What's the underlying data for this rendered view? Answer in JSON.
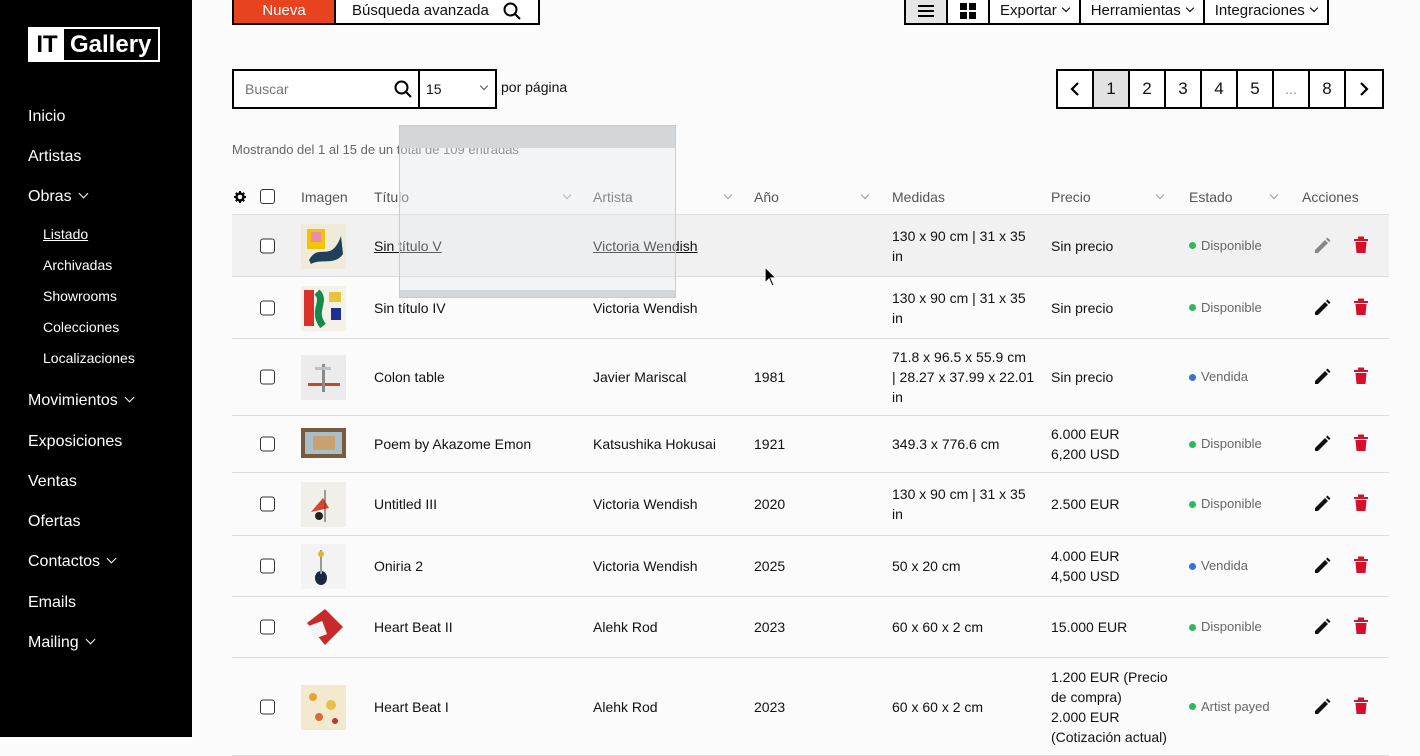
{
  "brand": {
    "it": "IT",
    "name": "Gallery"
  },
  "sidebar": {
    "items": [
      {
        "label": "Inicio"
      },
      {
        "label": "Artistas"
      },
      {
        "label": "Obras"
      },
      {
        "label": "Movimientos"
      },
      {
        "label": "Exposiciones"
      },
      {
        "label": "Ventas"
      },
      {
        "label": "Ofertas"
      },
      {
        "label": "Contactos"
      },
      {
        "label": "Emails"
      },
      {
        "label": "Mailing"
      }
    ],
    "subitems": [
      {
        "label": "Listado"
      },
      {
        "label": "Archivadas"
      },
      {
        "label": "Showrooms"
      },
      {
        "label": "Colecciones"
      },
      {
        "label": "Localizaciones"
      }
    ]
  },
  "toolbar": {
    "new_label": "Nueva",
    "advanced_search_label": "Búsqueda avanzada",
    "export_label": "Exportar",
    "tools_label": "Herramientas",
    "integrations_label": "Integraciones"
  },
  "search": {
    "placeholder": "Buscar",
    "per_page_value": "15",
    "per_page_label": "por página"
  },
  "pagination": {
    "pages": [
      "1",
      "2",
      "3",
      "4",
      "5",
      "...",
      "8"
    ],
    "current": "1"
  },
  "summary": "Mostrando del 1 al 15 de un total de 109 entradas",
  "table": {
    "headers": {
      "image": "Imagen",
      "title": "Título",
      "artist": "Artista",
      "year": "Año",
      "measures": "Medidas",
      "price": "Precio",
      "status": "Estado",
      "actions": "Acciones"
    },
    "rows": [
      {
        "title": "Sin título V",
        "artist": "Victoria Wendish",
        "year": "",
        "measures_1": "130 x 90 cm | 31 x 35",
        "measures_2": "in",
        "measures_3": "",
        "price_1": "Sin precio",
        "price_2": "",
        "price_3": "",
        "price_4": "",
        "status": "Disponible",
        "status_color": "#2eb85c"
      },
      {
        "title": "Sin título IV",
        "artist": "Victoria Wendish",
        "year": "",
        "measures_1": "130 x 90 cm | 31 x 35",
        "measures_2": "in",
        "measures_3": "",
        "price_1": "Sin precio",
        "price_2": "",
        "price_3": "",
        "price_4": "",
        "status": "Disponible",
        "status_color": "#2eb85c"
      },
      {
        "title": "Colon table",
        "artist": "Javier Mariscal",
        "year": "1981",
        "measures_1": "71.8 x 96.5 x 55.9 cm",
        "measures_2": "| 28.27 x 37.99 x 22.01",
        "measures_3": "in",
        "price_1": "Sin precio",
        "price_2": "",
        "price_3": "",
        "price_4": "",
        "status": "Vendida",
        "status_color": "#3b6fd6"
      },
      {
        "title": "Poem by Akazome Emon",
        "artist": "Katsushika Hokusai",
        "year": "1921",
        "measures_1": "349.3 x 776.6 cm",
        "measures_2": "",
        "measures_3": "",
        "price_1": "6.000 EUR",
        "price_2": "6,200 USD",
        "price_3": "",
        "price_4": "",
        "status": "Disponible",
        "status_color": "#2eb85c"
      },
      {
        "title": "Untitled III",
        "artist": "Victoria Wendish",
        "year": "2020",
        "measures_1": "130 x 90 cm | 31 x 35",
        "measures_2": "in",
        "measures_3": "",
        "price_1": "2.500 EUR",
        "price_2": "",
        "price_3": "",
        "price_4": "",
        "status": "Disponible",
        "status_color": "#2eb85c"
      },
      {
        "title": "Oniria 2",
        "artist": "Victoria Wendish",
        "year": "2025",
        "measures_1": "50 x 20 cm",
        "measures_2": "",
        "measures_3": "",
        "price_1": "4.000 EUR",
        "price_2": "4,500 USD",
        "price_3": "",
        "price_4": "",
        "status": "Vendida",
        "status_color": "#3b6fd6"
      },
      {
        "title": "Heart Beat II",
        "artist": "Alehk Rod",
        "year": "2023",
        "measures_1": "60 x 60 x 2 cm",
        "measures_2": "",
        "measures_3": "",
        "price_1": "15.000 EUR",
        "price_2": "",
        "price_3": "",
        "price_4": "",
        "status": "Disponible",
        "status_color": "#2eb85c"
      },
      {
        "title": "Heart Beat I",
        "artist": "Alehk Rod",
        "year": "2023",
        "measures_1": "60 x 60 x 2 cm",
        "measures_2": "",
        "measures_3": "",
        "price_1": "1.200 EUR (Precio",
        "price_2": "de compra)",
        "price_3": "2.000 EUR",
        "price_4": "(Cotización actual)",
        "status": "Artist payed",
        "status_color": "#2eb85c"
      }
    ]
  },
  "colors": {
    "accent": "#e8431f",
    "delete": "#d6102a",
    "available": "#2eb85c",
    "sold": "#3b6fd6"
  }
}
